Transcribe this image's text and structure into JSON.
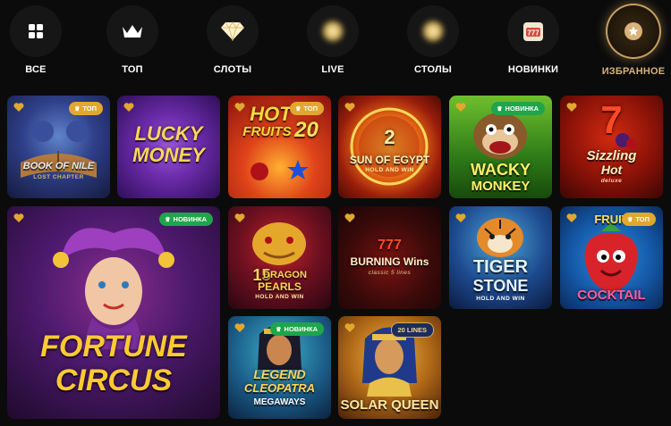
{
  "categories": [
    {
      "label": "ВСЕ",
      "icon": "grid-icon"
    },
    {
      "label": "ТОП",
      "icon": "crown-icon"
    },
    {
      "label": "СЛОТЫ",
      "icon": "diamond-icon"
    },
    {
      "label": "LIVE",
      "icon": "live-icon"
    },
    {
      "label": "СТОЛЫ",
      "icon": "tables-icon"
    },
    {
      "label": "НОВИНКИ",
      "icon": "slot-777-icon",
      "icon_text": "777"
    },
    {
      "label": "ИЗБРАННОЕ",
      "icon": "star-icon",
      "active": true
    }
  ],
  "badges": {
    "top": "ТОП",
    "new": "НОВИНКА",
    "lines": "20 LINES"
  },
  "games": [
    {
      "id": "book-of-nile",
      "title_line1": "BOOK OF NILE",
      "title_line2": "LOST CHAPTER"
    },
    {
      "id": "lucky-money",
      "title_line1": "LUCKY",
      "title_line2": "MONEY"
    },
    {
      "id": "hot-fruits-20",
      "title_line1": "HOT",
      "title_line2": "FRUITS",
      "title_num": "20"
    },
    {
      "id": "sun-of-egypt-2",
      "title_num": "2",
      "title_line1": "SUN OF EGYPT",
      "title_line2": "HOLD AND WIN"
    },
    {
      "id": "wacky-monkey",
      "title_line1": "WACKY",
      "title_line2": "MONKEY"
    },
    {
      "id": "sizzling-hot",
      "title_num": "7",
      "title_line1": "Sizzling",
      "title_line2": "Hot",
      "title_line3": "deluxe"
    },
    {
      "id": "fortune-circus",
      "title_line1": "FORTUNE",
      "title_line2": "CIRCUS"
    },
    {
      "id": "dragon-pearls",
      "title_num": "15",
      "title_line1": "DRAGON",
      "title_line2": "PEARLS",
      "title_line3": "HOLD AND WIN"
    },
    {
      "id": "burning-wins",
      "title_num": "777",
      "title_line1": "BURNING Wins",
      "title_line2": "classic 5 lines"
    },
    {
      "id": "tiger-stone",
      "title_line1": "TIGER",
      "title_line2": "STONE",
      "title_line3": "HOLD AND WIN"
    },
    {
      "id": "fruit-cocktail",
      "title_line1": "FRUIT",
      "title_line2": "COCKTAIL"
    },
    {
      "id": "legend-of-cleopatra",
      "title_line1": "LEGEND",
      "title_line2": "CLEOPATRA",
      "title_line3": "MEGAWAYS"
    },
    {
      "id": "solar-queen",
      "title_line1": "SOLAR QUEEN"
    }
  ],
  "colors": {
    "accent_gold": "#d8b27a",
    "badge_top": "#e0a82e",
    "badge_new": "#1fa54a",
    "heart": "#e0a82e"
  }
}
